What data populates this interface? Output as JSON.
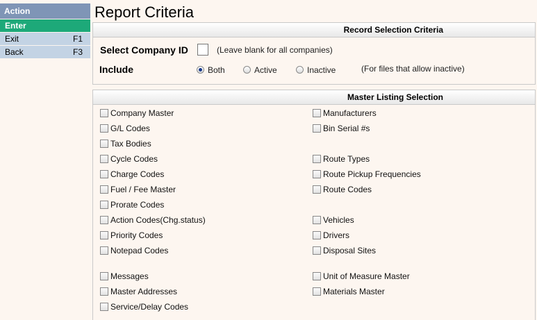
{
  "sidebar": {
    "header": "Action",
    "items": [
      {
        "label": "Enter",
        "key": ""
      },
      {
        "label": "Exit",
        "key": "F1"
      },
      {
        "label": "Back",
        "key": "F3"
      }
    ]
  },
  "page_title": "Report Criteria",
  "record_selection": {
    "header": "Record Selection Criteria",
    "company_label": "Select Company ID",
    "company_value": "",
    "company_hint": "(Leave blank for all companies)",
    "include_label": "Include",
    "options": [
      {
        "label": "Both",
        "selected": true
      },
      {
        "label": "Active",
        "selected": false
      },
      {
        "label": "Inactive",
        "selected": false
      }
    ],
    "include_hint": "(For files that allow inactive)"
  },
  "master_listing": {
    "header": "Master Listing Selection",
    "left": [
      "Company Master",
      "G/L Codes",
      "Tax Bodies",
      "Cycle Codes",
      "Charge Codes",
      "Fuel / Fee Master",
      "Prorate Codes",
      "Action Codes(Chg.status)",
      "Priority Codes",
      "Notepad Codes",
      "Messages",
      "Master Addresses",
      "Service/Delay Codes"
    ],
    "right": [
      "Manufacturers",
      "Bin Serial #s",
      "Route Types",
      "Route Pickup Frequencies",
      "Route Codes",
      "Vehicles",
      "Drivers",
      "Disposal Sites",
      "Unit of Measure Master",
      "Materials Master"
    ]
  }
}
